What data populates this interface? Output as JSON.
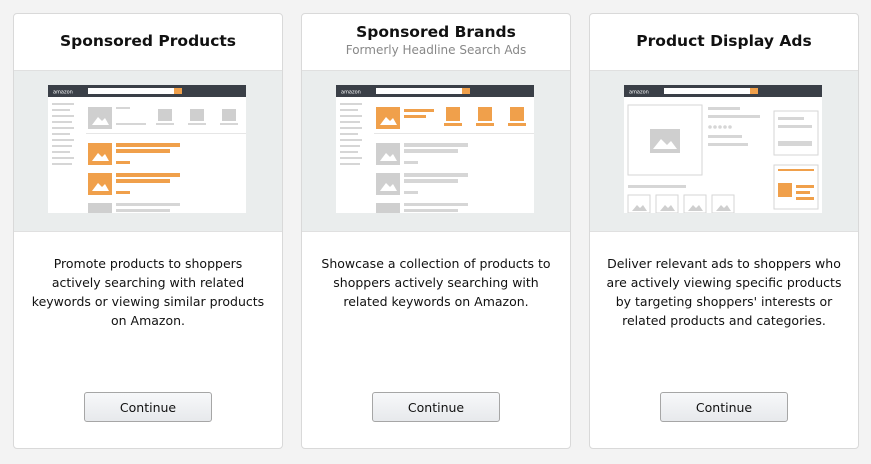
{
  "cards": [
    {
      "title": "Sponsored Products",
      "subtitle": "",
      "preview_icon": "sponsored-products-mockup",
      "description": "Promote products to shoppers actively searching with related keywords or viewing similar products on Amazon.",
      "button_label": "Continue"
    },
    {
      "title": "Sponsored Brands",
      "subtitle": "Formerly Headline Search Ads",
      "preview_icon": "sponsored-brands-mockup",
      "description": "Showcase a collection of products to shoppers actively searching with related keywords on Amazon.",
      "button_label": "Continue"
    },
    {
      "title": "Product Display Ads",
      "subtitle": "",
      "preview_icon": "product-display-ads-mockup",
      "description": "Deliver relevant ads to shoppers who are actively viewing specific products by targeting shoppers' interests or related products and categories.",
      "button_label": "Continue"
    }
  ],
  "mockup_logo": "amazon",
  "colors": {
    "accent_orange": "#f0a04b",
    "mockup_header": "#3a3f47",
    "placeholder_gray": "#cfcfcf",
    "preview_bg": "#eaeded"
  }
}
